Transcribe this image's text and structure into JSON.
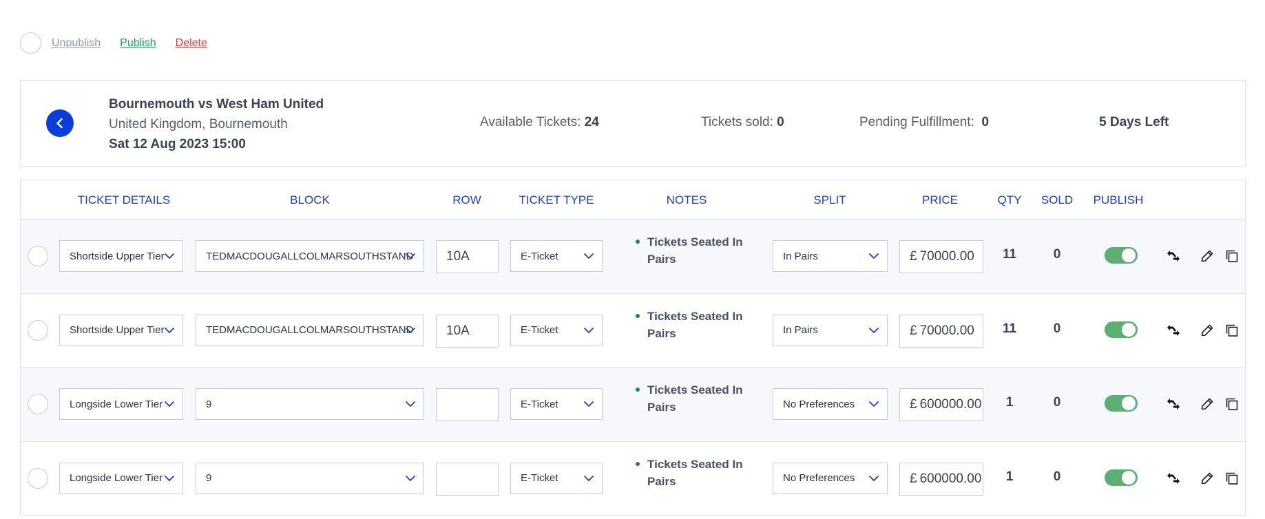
{
  "actions": {
    "unpublish": "Unpublish",
    "publish": "Publish",
    "delete": "Delete"
  },
  "event": {
    "title": "Bournemouth vs West Ham United",
    "location": "United Kingdom, Bournemouth",
    "date": "Sat 12 Aug 2023 15:00",
    "available_label": "Available Tickets:",
    "available_value": "24",
    "sold_label": "Tickets sold:",
    "sold_value": "0",
    "pending_label": "Pending Fulfillment:",
    "pending_value": "0",
    "days_left": "5 Days Left"
  },
  "table": {
    "headers": {
      "ticket_details": "TICKET DETAILS",
      "block": "BLOCK",
      "row": "ROW",
      "ticket_type": "TICKET TYPE",
      "notes": "NOTES",
      "split": "SPLIT",
      "price": "PRICE",
      "qty": "QTY",
      "sold": "SOLD",
      "publish": "PUBLISH"
    },
    "rows": [
      {
        "details": "Shortside Upper Tier",
        "block": "TEDMACDOUGALLCOLMARSOUTHSTAND",
        "row": "10A",
        "type": "E-Ticket",
        "notes": "Tickets Seated In Pairs",
        "split": "In Pairs",
        "currency": "£",
        "price": "70000.00",
        "qty": "11",
        "sold": "0",
        "published": true
      },
      {
        "details": "Shortside Upper Tier",
        "block": "TEDMACDOUGALLCOLMARSOUTHSTAND",
        "row": "10A",
        "type": "E-Ticket",
        "notes": "Tickets Seated In Pairs",
        "split": "In Pairs",
        "currency": "£",
        "price": "70000.00",
        "qty": "11",
        "sold": "0",
        "published": true
      },
      {
        "details": "Longside Lower Tier",
        "block": "9",
        "row": "",
        "type": "E-Ticket",
        "notes": "Tickets Seated In Pairs",
        "split": "No Preferences",
        "currency": "£",
        "price": "600000.00",
        "qty": "1",
        "sold": "0",
        "published": true
      },
      {
        "details": "Longside Lower Tier",
        "block": "9",
        "row": "",
        "type": "E-Ticket",
        "notes": "Tickets Seated In Pairs",
        "split": "No Preferences",
        "currency": "£",
        "price": "600000.00",
        "qty": "1",
        "sold": "0",
        "published": true
      }
    ]
  },
  "colors": {
    "accent": "#0b3ed8",
    "header_text": "#1a3fd0",
    "publish_link": "#1f9a5a",
    "delete_link": "#d93b3b",
    "toggle_on": "#5cae73"
  },
  "icons": [
    "chevron-left-icon",
    "chevron-down-icon",
    "move-arrows-icon",
    "pencil-icon",
    "copy-icon"
  ]
}
